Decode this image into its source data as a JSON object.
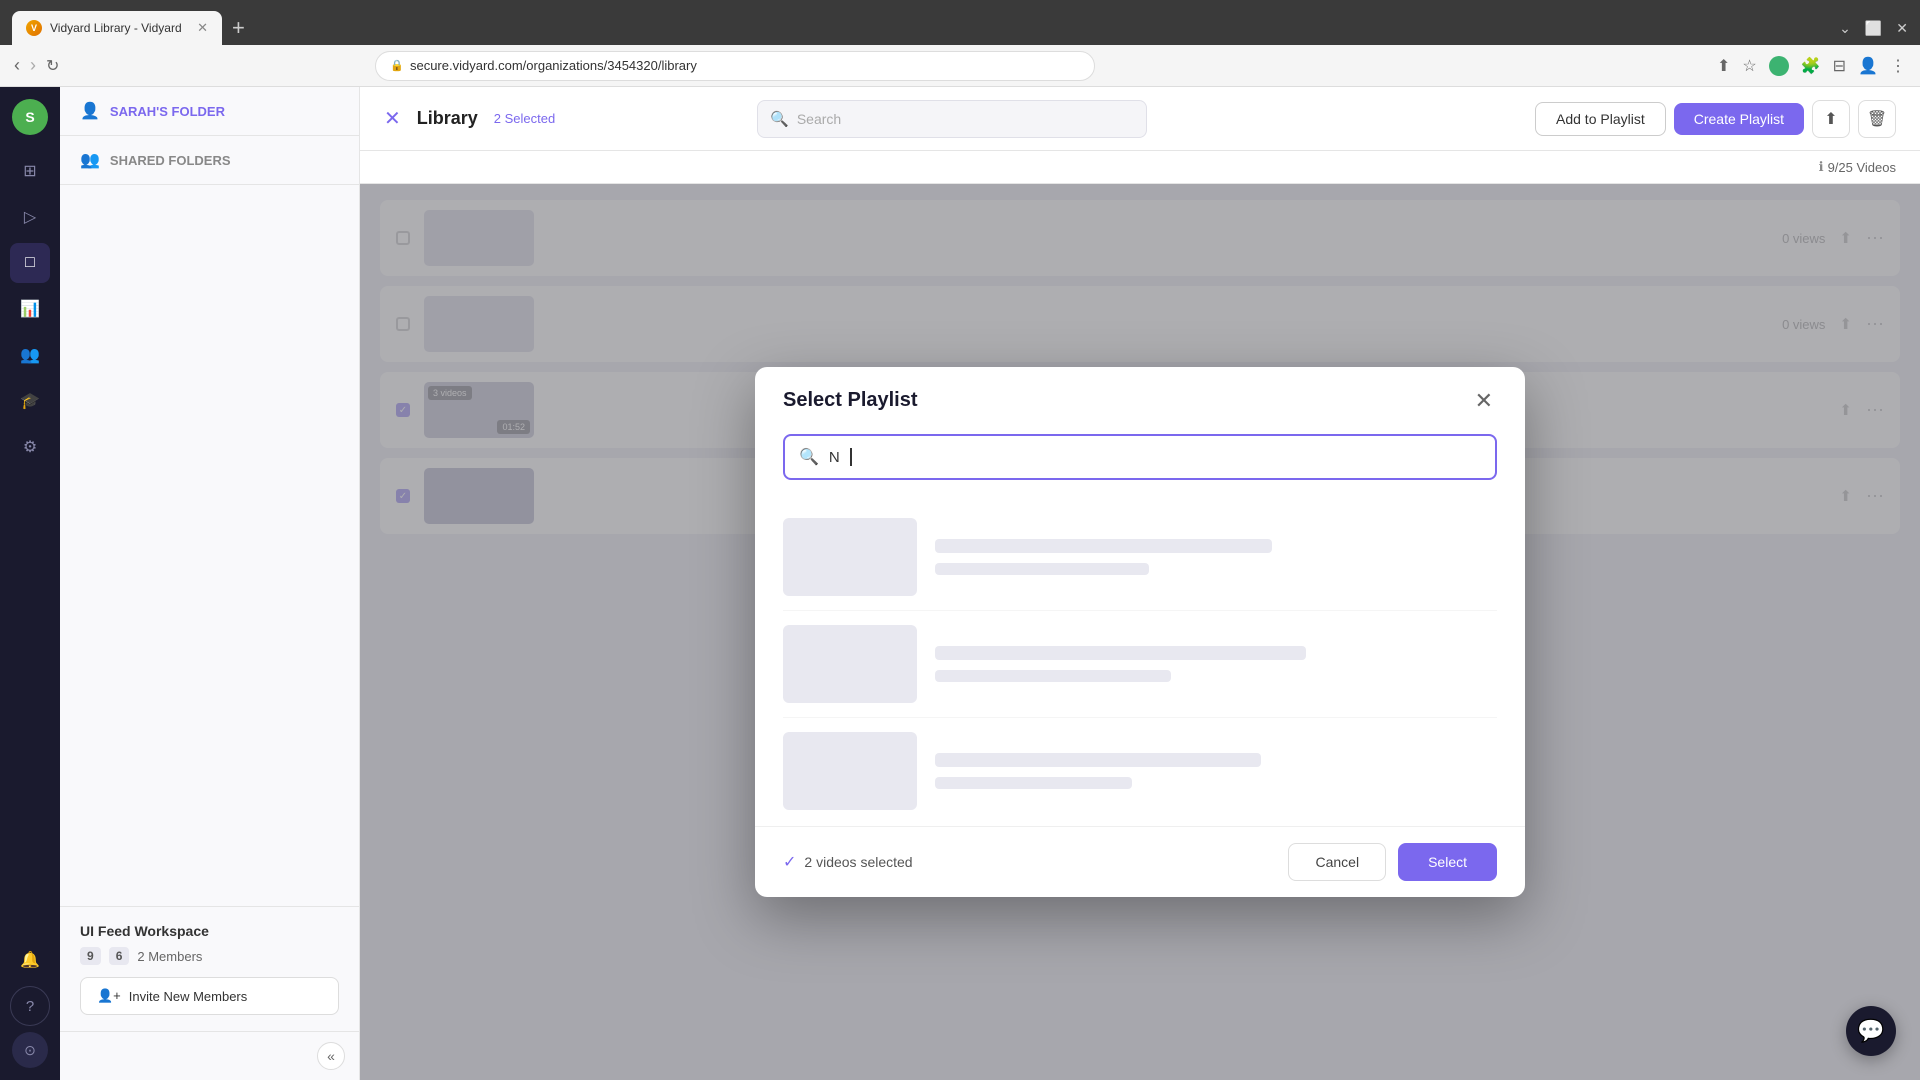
{
  "browser": {
    "tab_title": "Vidyard Library - Vidyard",
    "url": "secure.vidyard.com/organizations/3454320/library",
    "favicon_letter": "V"
  },
  "topbar": {
    "title": "Library",
    "selected_count": "2 Selected",
    "search_placeholder": "Search",
    "add_to_playlist_label": "Add to Playlist",
    "create_playlist_label": "Create Playlist"
  },
  "sidebar": {
    "avatar_letter": "S",
    "items": [
      {
        "name": "home",
        "icon": "⊞"
      },
      {
        "name": "video",
        "icon": "▷"
      },
      {
        "name": "folder",
        "icon": "□"
      },
      {
        "name": "analytics",
        "icon": "📊"
      },
      {
        "name": "users",
        "icon": "👥"
      },
      {
        "name": "hat",
        "icon": "🎓"
      },
      {
        "name": "settings",
        "icon": "⚙"
      },
      {
        "name": "bell",
        "icon": "🔔"
      },
      {
        "name": "help",
        "icon": "?"
      }
    ]
  },
  "left_panel": {
    "sarahs_folder_label": "SARAH'S FOLDER",
    "shared_folders_label": "SHARED FOLDERS",
    "workspace": {
      "name": "UI Feed Workspace",
      "stat1": "9",
      "stat2": "6",
      "members": "2 Members",
      "invite_label": "Invite New Members"
    }
  },
  "video_count": {
    "icon": "ℹ",
    "label": "9/25 Videos"
  },
  "video_cards": [
    {
      "views": "0 views"
    },
    {
      "views": "0 views"
    }
  ],
  "modal": {
    "title": "Select Playlist",
    "close_icon": "✕",
    "search_placeholder": "N",
    "search_icon": "🔍",
    "loading_items": [
      {
        "id": 1
      },
      {
        "id": 2
      },
      {
        "id": 3
      }
    ],
    "footer": {
      "videos_selected": "2 videos selected",
      "cancel_label": "Cancel",
      "select_label": "Select"
    }
  },
  "chat_widget": {
    "icon": "💬"
  }
}
